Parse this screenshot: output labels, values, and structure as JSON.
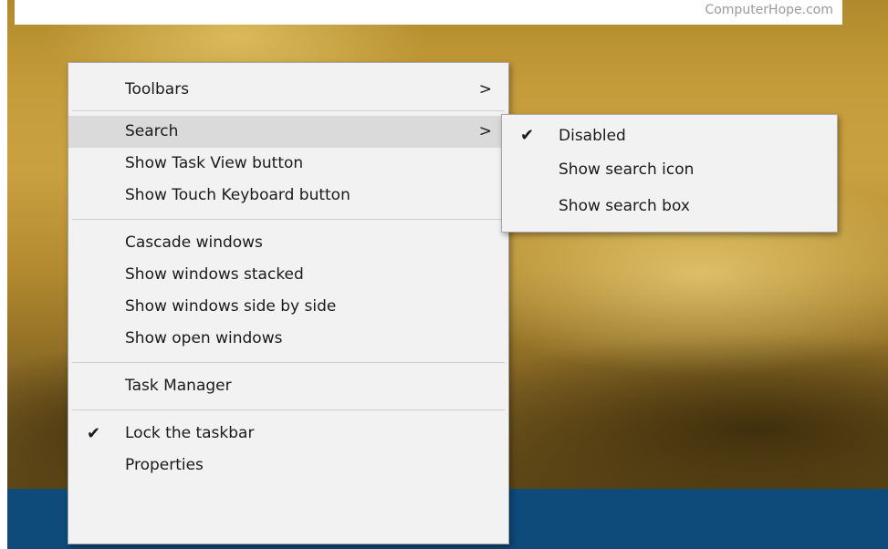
{
  "watermark": "ComputerHope.com",
  "menu": {
    "toolbars": "Toolbars",
    "search": "Search",
    "show_task_view": "Show Task View button",
    "show_touch_keyboard": "Show Touch Keyboard button",
    "cascade": "Cascade windows",
    "stacked": "Show windows stacked",
    "side_by_side": "Show windows side by side",
    "open_windows": "Show open windows",
    "task_manager": "Task Manager",
    "lock_taskbar": "Lock the taskbar",
    "properties": "Properties",
    "submenu_arrow": ">",
    "checkmark": "✔"
  },
  "search_submenu": {
    "disabled": "Disabled",
    "show_icon": "Show search icon",
    "show_box": "Show search box",
    "selected": "Disabled"
  },
  "colors": {
    "taskbar": "#0e4a7a",
    "menu_bg": "#f2f2f2",
    "hover_bg": "#dadada"
  }
}
